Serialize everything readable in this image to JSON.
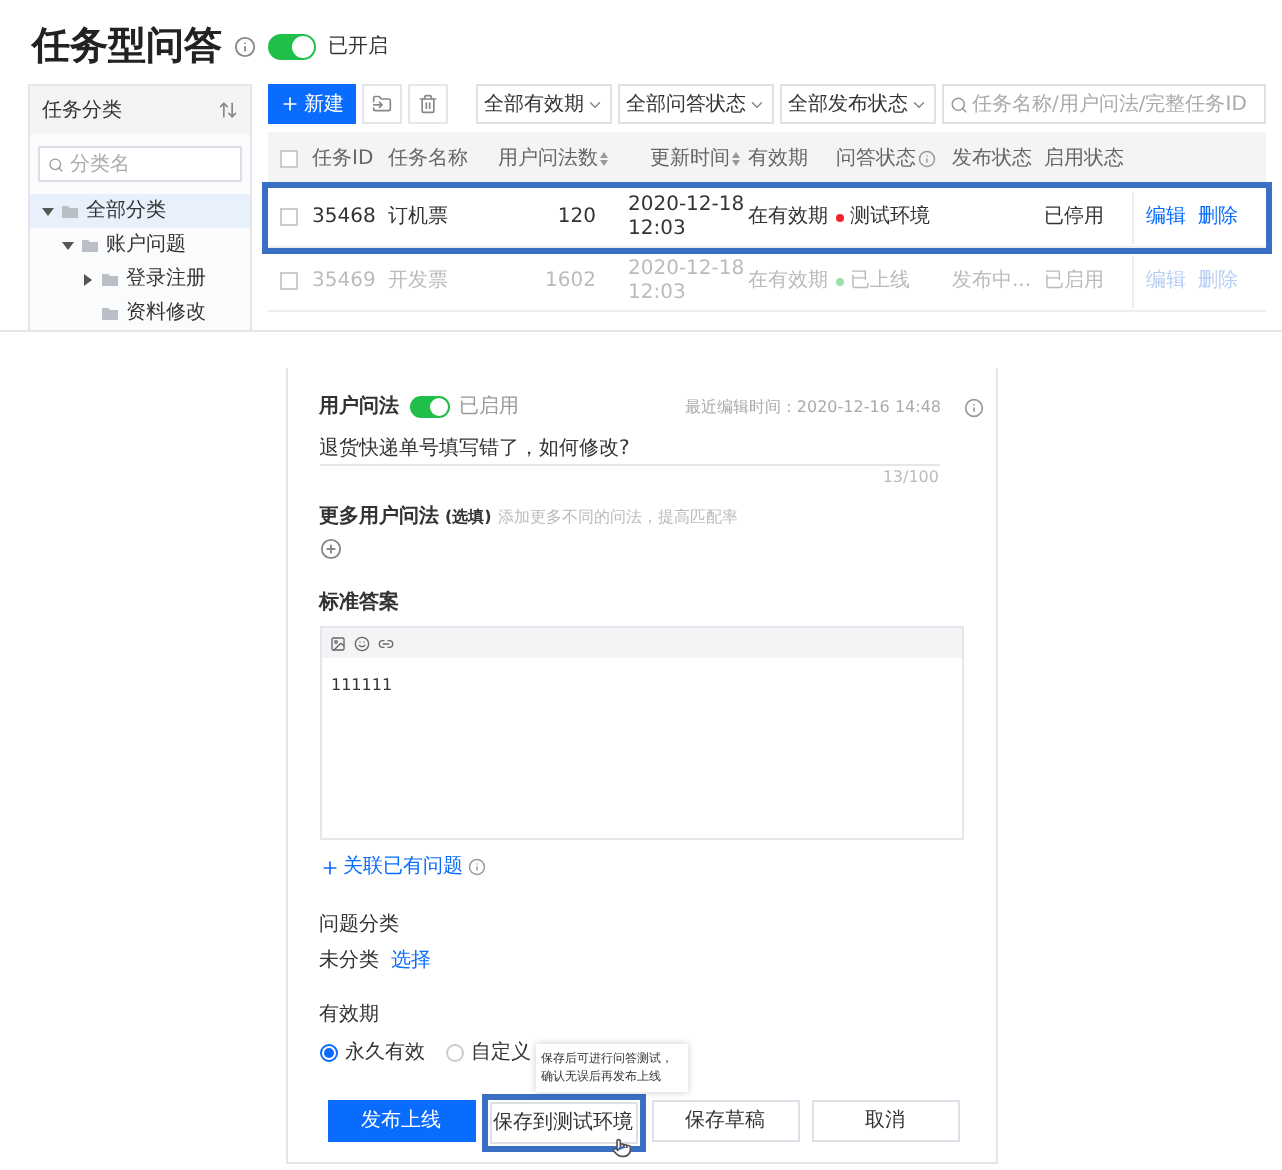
{
  "header": {
    "title": "任务型问答",
    "toggle": {
      "on": true,
      "label": "已开启"
    }
  },
  "sidebar": {
    "title": "任务分类",
    "search": {
      "placeholder": "分类名"
    },
    "tree": [
      {
        "label": "全部分类",
        "expanded": true,
        "selected": true,
        "children": [
          {
            "label": "账户问题",
            "expanded": true,
            "selected": false,
            "children": [
              {
                "label": "登录注册",
                "expanded": false,
                "selected": false
              },
              {
                "label": "资料修改",
                "selected": false
              }
            ]
          }
        ]
      }
    ]
  },
  "toolbar": {
    "new_button": "新建",
    "filters": [
      "全部有效期",
      "全部问答状态",
      "全部发布状态"
    ],
    "search": {
      "placeholder": "任务名称/用户问法/完整任务ID"
    }
  },
  "table": {
    "select_all_checked": false,
    "columns": [
      {
        "label": "任务ID"
      },
      {
        "label": "任务名称"
      },
      {
        "label": "用户问法数",
        "sortable": true
      },
      {
        "label": "更新时间",
        "sortable": true
      },
      {
        "label": "有效期"
      },
      {
        "label": "问答状态",
        "info": true
      },
      {
        "label": "发布状态"
      },
      {
        "label": "启用状态"
      }
    ],
    "rows": [
      {
        "checked": false,
        "id": "35468",
        "name": "订机票",
        "count": "120",
        "time": [
          "2020-12-18",
          "12:03"
        ],
        "validity": "在有效期",
        "qa_status": "测试环境",
        "color": "#f5222d",
        "publish": "",
        "enable": "已停用",
        "actions": [
          "编辑",
          "删除"
        ],
        "disabled": false,
        "highlighted": true
      },
      {
        "checked": false,
        "id": "35469",
        "name": "开发票",
        "count": "1602",
        "time": [
          "2020-12-18",
          "12:03"
        ],
        "validity": "在有效期",
        "qa_status": "已上线",
        "color": "#9be0a8",
        "publish": "发布中...",
        "enable": "已启用",
        "actions": [
          "编辑",
          "删除"
        ],
        "disabled": true,
        "highlighted": false
      }
    ]
  },
  "form": {
    "question": {
      "label": "用户问法",
      "toggle": {
        "on": true,
        "label": "已启用"
      },
      "edited": "最近编辑时间：2020-12-16 14:48",
      "value": "退货快递单号填写错了，如何修改?",
      "counter": "13/100"
    },
    "more": {
      "label": "更多用户问法",
      "optional": "(选填)",
      "hint": "添加更多不同的问法，提高匹配率"
    },
    "answer": {
      "label": "标准答案",
      "content": "111111",
      "link": "关联已有问题"
    },
    "category": {
      "label": "问题分类",
      "value": "未分类",
      "link": "选择"
    },
    "validity": {
      "label": "有效期",
      "options": [
        {
          "label": "永久有效",
          "selected": true
        },
        {
          "label": "自定义",
          "selected": false
        }
      ]
    },
    "tooltip": [
      "保存后可进行问答测试，",
      "确认无误后再发布上线"
    ],
    "buttons": [
      {
        "label": "发布上线",
        "kind": "primary",
        "highlighted": false
      },
      {
        "label": "保存到测试环境",
        "kind": "default",
        "highlighted": true
      },
      {
        "label": "保存草稿",
        "kind": "default",
        "highlighted": false
      },
      {
        "label": "取消",
        "kind": "default",
        "highlighted": false
      }
    ]
  }
}
